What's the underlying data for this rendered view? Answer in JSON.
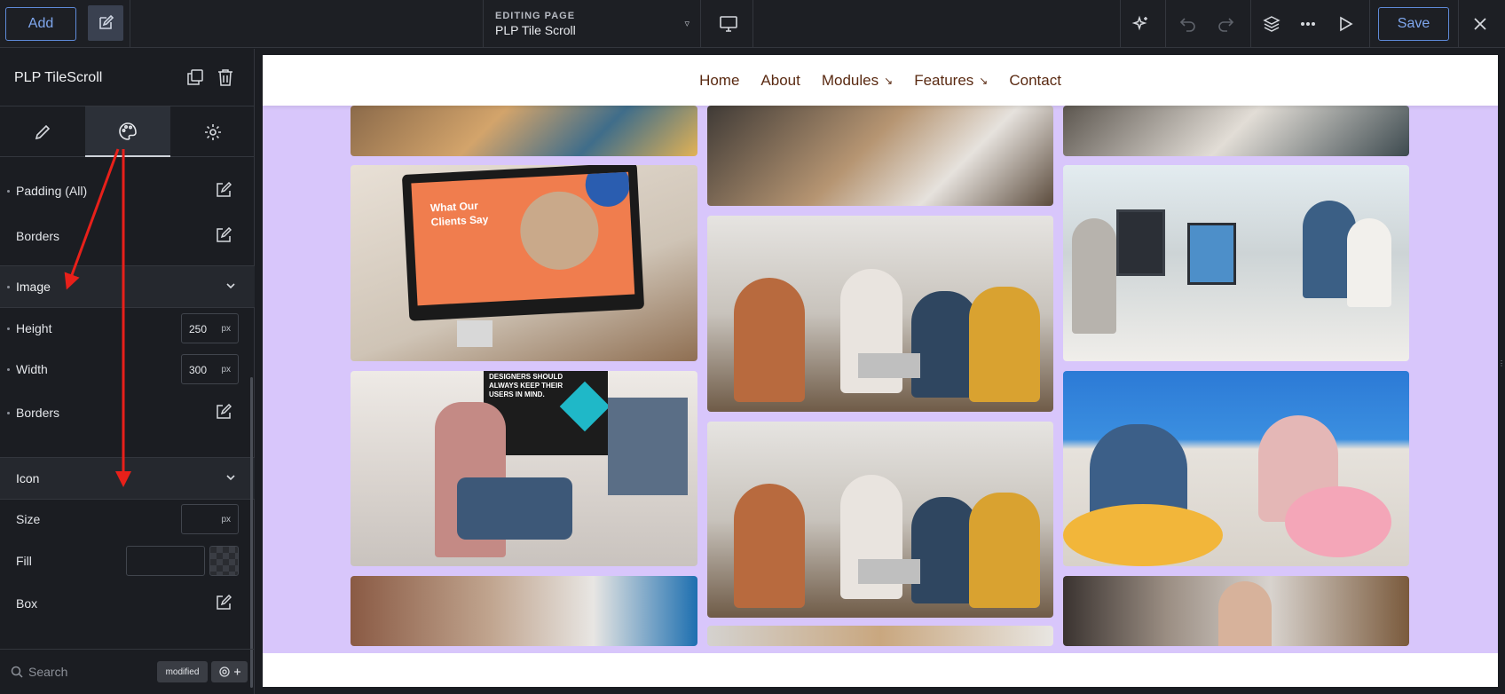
{
  "topbar": {
    "add_label": "Add",
    "editing_caption": "EDITING PAGE",
    "page_name": "PLP Tile Scroll",
    "save_label": "Save"
  },
  "sidebar": {
    "title": "PLP TileScroll",
    "rows": {
      "padding_all": "Padding (All)",
      "borders": "Borders"
    },
    "image_section": {
      "label": "Image",
      "height_label": "Height",
      "height_value": "250",
      "height_unit": "px",
      "width_label": "Width",
      "width_value": "300",
      "width_unit": "px",
      "borders_label": "Borders"
    },
    "icon_section": {
      "label": "Icon",
      "size_label": "Size",
      "size_value": "",
      "size_unit": "px",
      "fill_label": "Fill",
      "box_label": "Box"
    },
    "search": {
      "placeholder": "Search",
      "modified_chip": "modified"
    }
  },
  "page": {
    "nav": {
      "home": "Home",
      "about": "About",
      "modules": "Modules",
      "features": "Features",
      "contact": "Contact"
    },
    "tiles": [
      {
        "name": "team-with-tablet-photo"
      },
      {
        "name": "laptop-meeting-photo"
      },
      {
        "name": "office-desk-photo"
      },
      {
        "name": "monitor-testimonial-photo"
      },
      {
        "name": "group-laptop-discussion-photo"
      },
      {
        "name": "open-office-computers-photo"
      },
      {
        "name": "woman-phone-desk-photo"
      },
      {
        "name": "group-laptop-discussion-photo-2"
      },
      {
        "name": "beanbag-conversation-photo"
      },
      {
        "name": "brick-office-laptop-photo"
      },
      {
        "name": "bookshelf-photo"
      },
      {
        "name": "woman-portrait-photo"
      }
    ],
    "monitor_text": {
      "line1": "What Our",
      "line2": "Clients Say"
    },
    "poster_text": {
      "line1": "DESIGNERS SHOULD",
      "line2": "ALWAYS KEEP THEIR",
      "line3": "USERS IN MIND."
    }
  },
  "colors": {
    "accent": "#5e8ad8",
    "canvas_bg": "#d8c6fb",
    "nav_text": "#5a2a12",
    "arrow": "#e8201a"
  }
}
